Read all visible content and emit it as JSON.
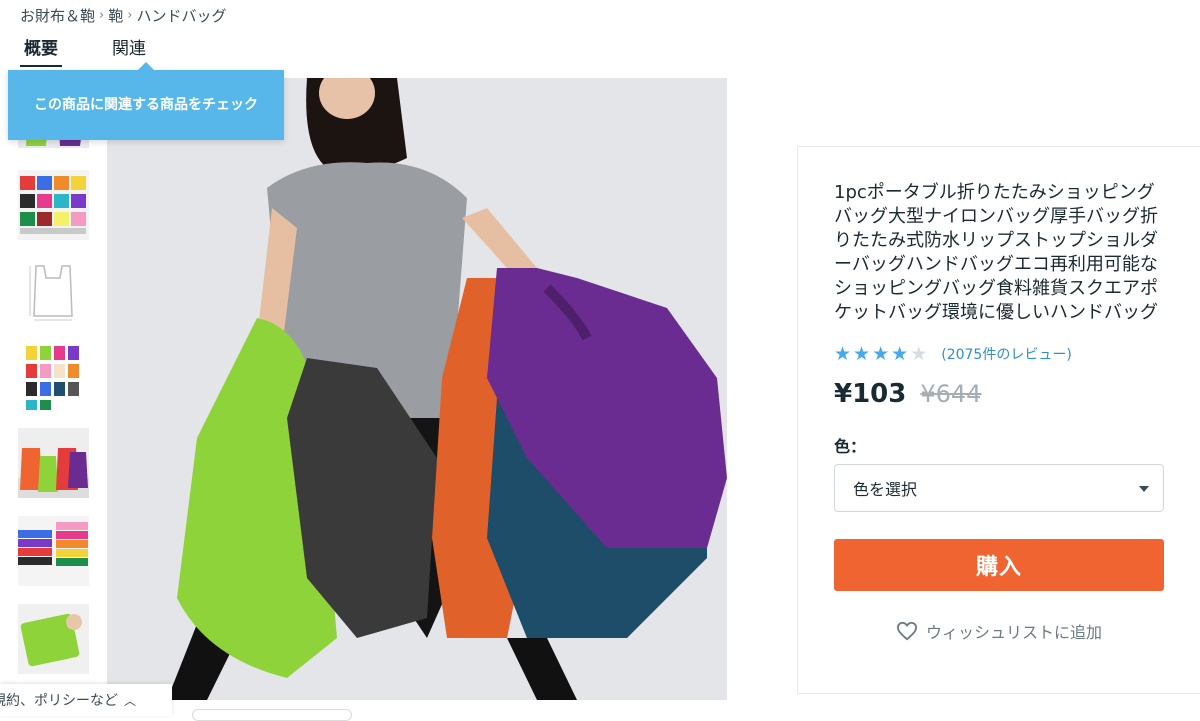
{
  "breadcrumb": {
    "items": [
      "お財布＆鞄",
      "鞄",
      "ハンドバッグ"
    ],
    "separator": "›"
  },
  "tabs": [
    {
      "label": "概要",
      "active": true
    },
    {
      "label": "関連",
      "active": false
    }
  ],
  "tooltip": {
    "text": "この商品に関連する商品をチェック"
  },
  "gallery": {
    "thumbnails": [
      "bags-thumbnail",
      "color-grid-thumbnail",
      "size-diagram-thumbnail",
      "color-swatches-thumbnail",
      "model-bags-thumbnail",
      "folded-stack-thumbnail",
      "green-pouch-thumbnail"
    ],
    "main_image": "woman-holding-shopping-bags"
  },
  "product": {
    "title": "1pcポータブル折りたたみショッピングバッグ大型ナイロンバッグ厚手バッグ折りたたみ式防水リップストップショルダーバッグハンドバッグエコ再利用可能なショッピングバッグ食料雑貨スクエアポケットバッグ環境に優しいハンドバッグ",
    "rating": 4,
    "rating_max": 5,
    "review_count": "(2075件のレビュー)",
    "price": "¥103",
    "original_price": "¥644",
    "color_label": "色：",
    "color_select_placeholder": "色を選択",
    "buy_label": "購入",
    "wishlist_label": "ウィッシュリストに追加"
  },
  "footer": {
    "link_label": "規約、ポリシーなど"
  },
  "colors": {
    "accent": "#57b6ea",
    "buy": "#f06432",
    "star": "#46a9ea",
    "text": "#192a32"
  }
}
